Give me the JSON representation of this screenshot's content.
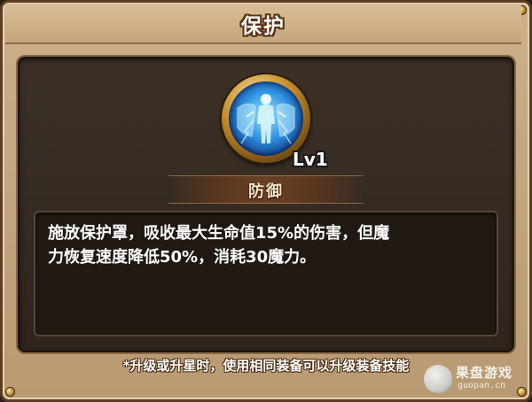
{
  "window": {
    "title": "保护"
  },
  "skill": {
    "icon": "shield-figure-icon",
    "level": "Lv1",
    "type": "防御",
    "description_line1": "施放保护罩，吸收最大生命值15%的伤害，但魔",
    "description_line2": "力恢复速度降低50%，消耗30魔力。"
  },
  "footer": {
    "note": "*升级或升星时，使用相同装备可以升级装备技能"
  },
  "watermark": {
    "name": "果盘游戏",
    "url": "guopan.cn"
  },
  "colors": {
    "frame": "#c6a67c",
    "panel": "#3d3127",
    "icon_glow": "#2c8fe0",
    "text": "#ffffff"
  }
}
